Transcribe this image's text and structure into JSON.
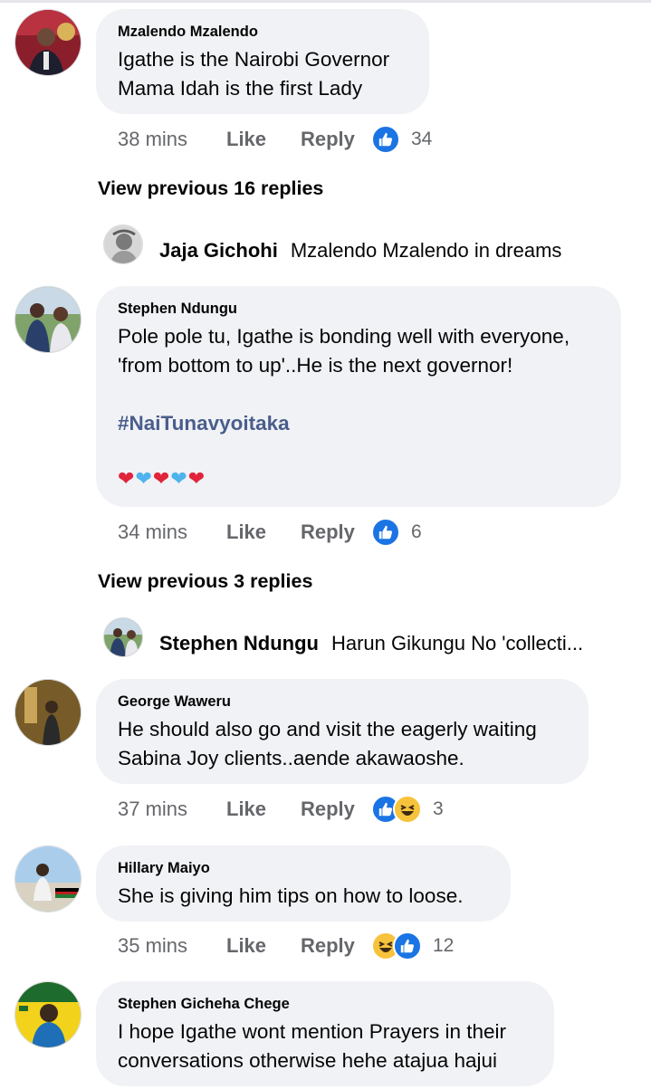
{
  "comments": [
    {
      "author": "Mzalendo Mzalendo",
      "lines": [
        "Igathe is the Nairobi Governor",
        "Mama Idah is the first Lady"
      ],
      "time": "38 mins",
      "like_label": "Like",
      "reply_label": "Reply",
      "reactions": [
        "like"
      ],
      "reaction_count": "34"
    },
    {
      "author": "Stephen Ndungu",
      "lines": [
        "Pole pole tu, Igathe is bonding well with everyone,",
        "'from bottom to up'..He is the next governor!"
      ],
      "hashtag": "#NaiTunavyoitaka",
      "hearts": [
        "red",
        "blue",
        "red",
        "blue",
        "red"
      ],
      "time": "34 mins",
      "like_label": "Like",
      "reply_label": "Reply",
      "reactions": [
        "like"
      ],
      "reaction_count": "6"
    },
    {
      "author": "George Waweru",
      "lines": [
        "He should also go and visit the eagerly waiting",
        "Sabina Joy clients..aende akawaoshe."
      ],
      "time": "37 mins",
      "like_label": "Like",
      "reply_label": "Reply",
      "reactions": [
        "like",
        "haha"
      ],
      "reaction_count": "3"
    },
    {
      "author": "Hillary Maiyo",
      "lines": [
        "She is giving him tips on how to loose."
      ],
      "time": "35 mins",
      "like_label": "Like",
      "reply_label": "Reply",
      "reactions": [
        "haha",
        "like"
      ],
      "reaction_count": "12"
    },
    {
      "author": "Stephen Gicheha Chege",
      "lines": [
        "I hope Igathe wont mention Prayers in their",
        "conversations otherwise hehe atajua hajui"
      ]
    }
  ],
  "view_previous": [
    "View previous 16 replies",
    "View previous 3 replies"
  ],
  "reply_previews": [
    {
      "name": "Jaja Gichohi",
      "text": "Mzalendo Mzalendo in dreams"
    },
    {
      "name": "Stephen Ndungu",
      "text": "Harun Gikungu No 'collecti..."
    }
  ],
  "colors": {
    "bubble_bg": "#f0f2f5",
    "meta_text": "#65676b",
    "hashtag": "#4a5d8c",
    "like_blue": "#1b74e4",
    "haha_yellow": "#f7c33c"
  }
}
